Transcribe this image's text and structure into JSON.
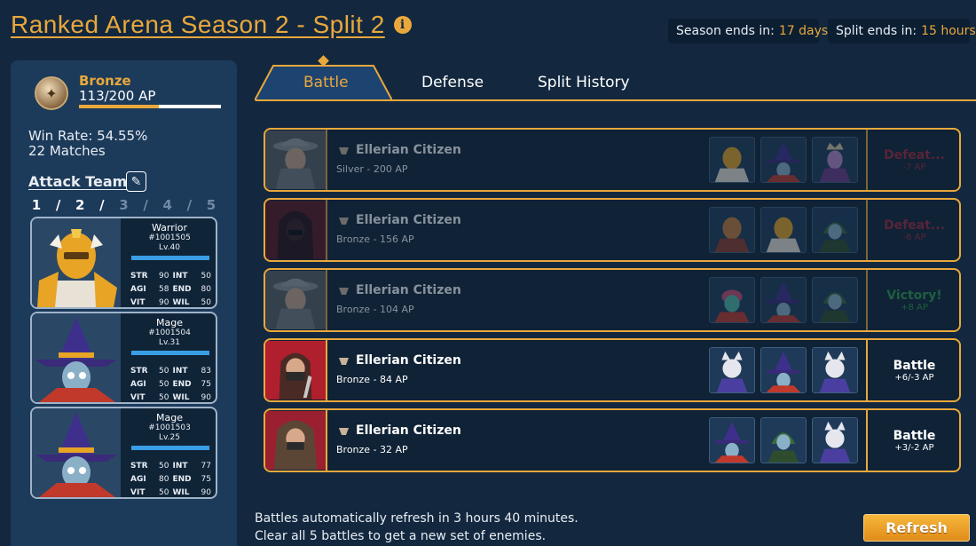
{
  "header": {
    "title": "Ranked Arena Season 2 - Split 2",
    "season_label": "Season ends in:",
    "season_value": "17 days",
    "split_label": "Split ends in:",
    "split_value": "15 hours"
  },
  "profile": {
    "rank": "Bronze",
    "ap": "113/200 AP",
    "ap_progress": 0.565,
    "win_rate": "Win Rate: 54.55%",
    "matches": "22 Matches",
    "team_label": "Attack Team",
    "pages": [
      "1",
      "2",
      "3",
      "4",
      "5"
    ],
    "page_separator": "/"
  },
  "heroes": [
    {
      "class": "Warrior",
      "id": "#1001505",
      "level": "Lv.40",
      "stats": [
        [
          "STR",
          "90",
          "INT",
          "50"
        ],
        [
          "AGI",
          "58",
          "END",
          "80"
        ],
        [
          "VIT",
          "90",
          "WIL",
          "50"
        ]
      ]
    },
    {
      "class": "Mage",
      "id": "#1001504",
      "level": "Lv.31",
      "stats": [
        [
          "STR",
          "50",
          "INT",
          "83"
        ],
        [
          "AGI",
          "50",
          "END",
          "75"
        ],
        [
          "VIT",
          "50",
          "WIL",
          "90"
        ]
      ]
    },
    {
      "class": "Mage",
      "id": "#1001503",
      "level": "Lv.25",
      "stats": [
        [
          "STR",
          "50",
          "INT",
          "77"
        ],
        [
          "AGI",
          "80",
          "END",
          "75"
        ],
        [
          "VIT",
          "50",
          "WIL",
          "90"
        ]
      ]
    }
  ],
  "tabs": [
    "Battle",
    "Defense",
    "Split History"
  ],
  "battles": [
    {
      "name": "Ellerian Citizen",
      "ap": "Silver - 200 AP",
      "result": "Defeat...",
      "delta": "-7 AP",
      "kind": "defeat"
    },
    {
      "name": "Ellerian Citizen",
      "ap": "Bronze - 156 AP",
      "result": "Defeat...",
      "delta": "-6 AP",
      "kind": "defeat"
    },
    {
      "name": "Ellerian Citizen",
      "ap": "Bronze - 104 AP",
      "result": "Victory!",
      "delta": "+8 AP",
      "kind": "victory"
    },
    {
      "name": "Ellerian Citizen",
      "ap": "Bronze - 84 AP",
      "result": "Battle",
      "delta": "+6/-3 AP",
      "kind": "battle"
    },
    {
      "name": "Ellerian Citizen",
      "ap": "Bronze - 32 AP",
      "result": "Battle",
      "delta": "+3/-2 AP",
      "kind": "battle"
    }
  ],
  "footer": {
    "line1": "Battles automatically refresh in 3 hours 40 minutes.",
    "line2": "Clear all 5 battles to get a new set of enemies.",
    "refresh_label": "Refresh"
  },
  "colors": {
    "accent": "#e9a83c",
    "defeat": "#a2263b",
    "victory": "#2f9b4a",
    "background": "#13283f"
  }
}
